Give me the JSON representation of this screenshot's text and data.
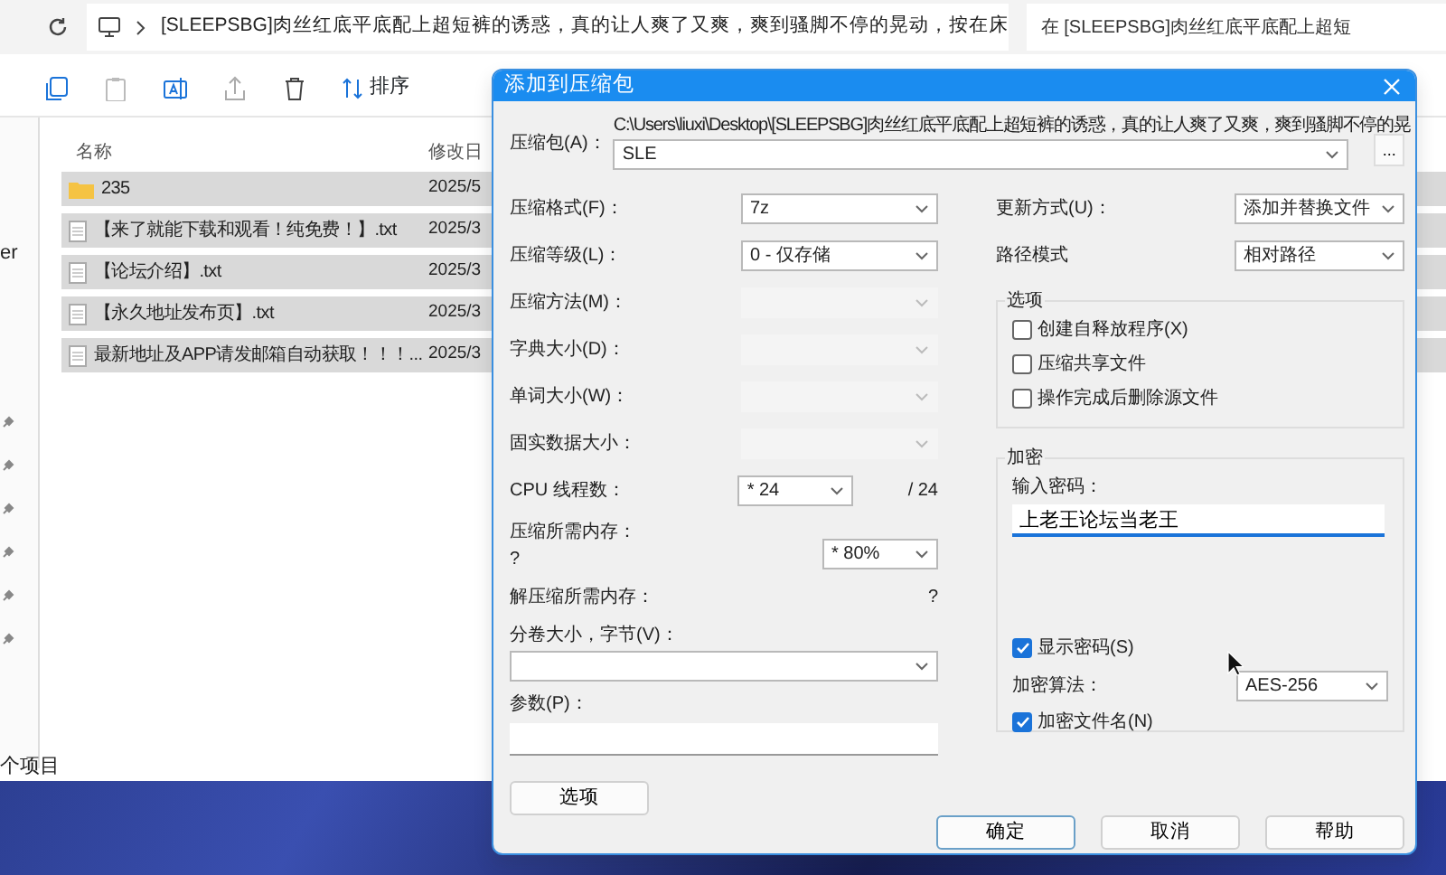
{
  "address_bar": {
    "path": "[SLEEPSBG]肉丝红底平底配上超短裤的诱惑，真的让人爽了又爽，爽到骚脚不停的晃动，按在床"
  },
  "search": {
    "placeholder": "在 [SLEEPSBG]肉丝红底平底配上超短"
  },
  "toolbar": {
    "sort_label": "排序"
  },
  "nav_pane": {
    "fragment": "er"
  },
  "file_list": {
    "columns": [
      "名称",
      "修改日"
    ],
    "rows": [
      {
        "kind": "folder",
        "name": "235",
        "date": "2025/5",
        "selected": true
      },
      {
        "kind": "file",
        "name": "【来了就能下载和观看！纯免费！】.txt",
        "date": "2025/3",
        "selected": true
      },
      {
        "kind": "file",
        "name": "【论坛介绍】.txt",
        "date": "2025/3",
        "selected": true
      },
      {
        "kind": "file",
        "name": "【永久地址发布页】.txt",
        "date": "2025/3",
        "selected": true
      },
      {
        "kind": "file",
        "name": "最新地址及APP请发邮箱自动获取！！！...",
        "date": "2025/3",
        "selected": true
      }
    ]
  },
  "status_bar": "个项目",
  "dialog": {
    "title": "添加到压缩包",
    "archive": {
      "label": "压缩包(A)：",
      "path": "C:\\Users\\liuxi\\Desktop\\[SLEEPSBG]肉丝红底平底配上超短裤的诱惑，真的让人爽了又爽，爽到骚脚不停的晃",
      "value": "SLE",
      "browse": "..."
    },
    "left_fields": [
      {
        "kind": "select",
        "label": "压缩格式(F)：",
        "value": "7z",
        "disabled": false
      },
      {
        "kind": "select",
        "label": "压缩等级(L)：",
        "value": "0 - 仅存储",
        "disabled": false
      },
      {
        "kind": "select",
        "label": "压缩方法(M)：",
        "disabled": true
      },
      {
        "kind": "select",
        "label": "字典大小(D)：",
        "disabled": true
      },
      {
        "kind": "select",
        "label": "单词大小(W)：",
        "disabled": true
      },
      {
        "kind": "select",
        "label": "固实数据大小：",
        "disabled": true
      },
      {
        "kind": "threads",
        "label": "CPU 线程数：",
        "value": "* 24",
        "suffix": "/ 24"
      },
      {
        "kind": "memory",
        "label": "压缩所需内存：",
        "note": "?",
        "value": "* 80%"
      },
      {
        "kind": "info",
        "label": "解压缩所需内存：",
        "note": "?"
      },
      {
        "kind": "wide_combo",
        "label": "分卷大小，字节(V)："
      },
      {
        "kind": "wide_text",
        "label": "参数(P)："
      }
    ],
    "options_button": "选项",
    "right_fields": [
      {
        "label": "更新方式(U)：",
        "value": "添加并替换文件"
      },
      {
        "label": "路径模式",
        "value": "相对路径"
      }
    ],
    "options_group": {
      "title": "选项",
      "checkboxes": [
        {
          "label": "创建自释放程序(X)",
          "checked": false
        },
        {
          "label": "压缩共享文件",
          "checked": false
        },
        {
          "label": "操作完成后删除源文件",
          "checked": false
        }
      ]
    },
    "encryption": {
      "title": "加密",
      "password_label": "输入密码：",
      "password": "上老王论坛当老王",
      "show_password": {
        "label": "显示密码(S)",
        "checked": true
      },
      "method_label": "加密算法：",
      "method": "AES-256",
      "encrypt_names": {
        "label": "加密文件名(N)",
        "checked": true
      }
    },
    "buttons": [
      {
        "label": "确定",
        "default": true
      },
      {
        "label": "取消",
        "default": false
      },
      {
        "label": "帮助",
        "default": false
      }
    ]
  }
}
